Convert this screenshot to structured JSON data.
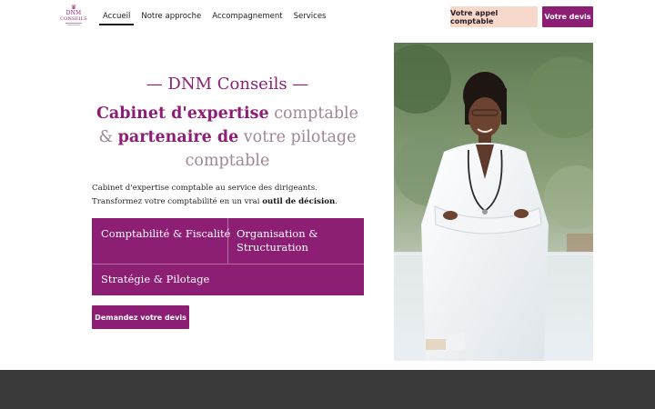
{
  "header": {
    "logo": {
      "line1": "DNM",
      "line2": "CONSEILS"
    },
    "nav": [
      {
        "label": "Accueil",
        "active": true
      },
      {
        "label": "Notre approche",
        "active": false
      },
      {
        "label": "Accompagnement",
        "active": false
      },
      {
        "label": "Services",
        "active": false
      }
    ],
    "call_button": "Votre appel comptable",
    "quote_button": "Votre devis"
  },
  "hero": {
    "brand": "— DNM Conseils —",
    "headline": {
      "part1": "Cabinet d'expertise",
      "part2": " comptable & ",
      "part3": "partenaire de",
      "part4": " votre pilotage comptable"
    },
    "intro": {
      "text": "Cabinet d'expertise comptable au service des dirigeants. Transformez votre comptabilité en un vrai ",
      "emphasis": "outil de décision",
      "end": "."
    },
    "services": [
      "Comptabilité & Fiscalité",
      "Organisation & Structuration",
      "Stratégie & Pilotage"
    ],
    "cta": "Demandez votre devis"
  },
  "colors": {
    "brand_purple": "#8c1f74",
    "peach": "#f6d9cb",
    "footer": "#3a3a3a"
  }
}
